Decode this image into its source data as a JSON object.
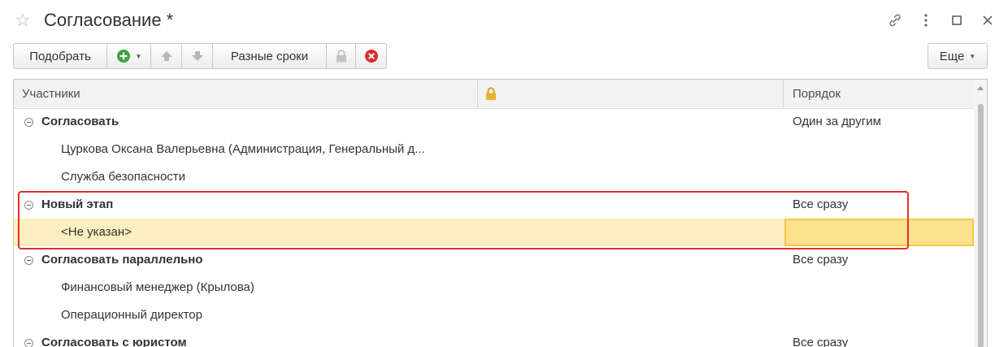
{
  "window": {
    "title": "Согласование *"
  },
  "toolbar": {
    "pick_label": "Подобрать",
    "different_terms_label": "Разные сроки",
    "more_label": "Еще"
  },
  "table": {
    "columns": {
      "participants": "Участники",
      "order": "Порядок"
    },
    "rows": [
      {
        "name": "Согласовать",
        "order": "Один за другим"
      },
      {
        "name": "Цуркова Оксана Валерьевна (Администрация, Генеральный д...",
        "order": ""
      },
      {
        "name": "Служба безопасности",
        "order": ""
      },
      {
        "name": "Новый этап",
        "order": "Все сразу"
      },
      {
        "name": "<Не указан>",
        "order": ""
      },
      {
        "name": "Согласовать параллельно",
        "order": "Все сразу"
      },
      {
        "name": "Финансовый менеджер (Крылова)",
        "order": ""
      },
      {
        "name": "Операционный директор",
        "order": ""
      },
      {
        "name": "Согласовать с юристом",
        "order": "Все сразу"
      }
    ]
  },
  "colors": {
    "selected_row": "#fbeec0",
    "highlight": "#e0302c",
    "accent_green": "#3aa33a",
    "delete_red": "#d9302c"
  }
}
